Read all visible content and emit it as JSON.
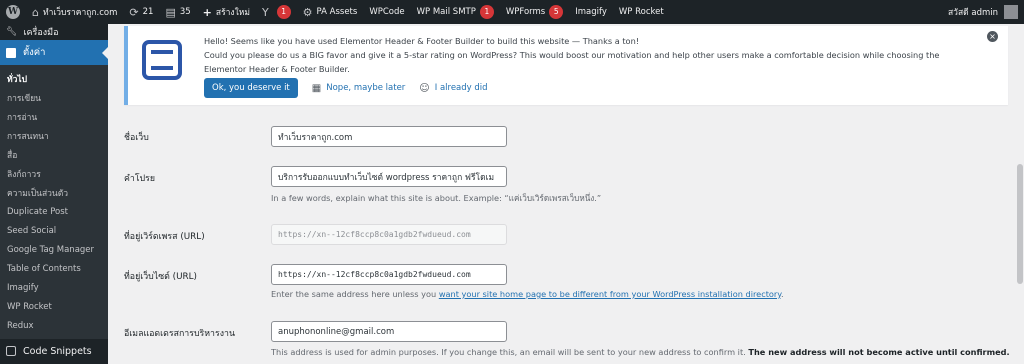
{
  "adminbar": {
    "site_name": "ทำเว็บราคาถูก.com",
    "updates_count": "21",
    "comments_count": "35",
    "new_label": "สร้างใหม่",
    "yoast_badge": "1",
    "pa_assets": "PA Assets",
    "wpcode": "WPCode",
    "wp_mail_smtp": "WP Mail SMTP",
    "wp_mail_smtp_badge": "1",
    "wpforms": "WPForms",
    "wpforms_badge": "5",
    "imagify": "Imagify",
    "wp_rocket": "WP Rocket",
    "greeting": "สวัสดี admin"
  },
  "sidebar": {
    "tools": "เครื่องมือ",
    "settings": "ตั้งค่า",
    "items": [
      "ทั่วไป",
      "การเขียน",
      "การอ่าน",
      "การสนทนา",
      "สื่อ",
      "ลิงก์ถาวร",
      "ความเป็นส่วนตัว",
      "Duplicate Post",
      "Seed Social",
      "Google Tag Manager",
      "Table of Contents",
      "Imagify",
      "WP Rocket",
      "Redux"
    ],
    "code_snippets": "Code Snippets"
  },
  "notice": {
    "line1": "Hello! Seems like you have used Elementor Header & Footer Builder to build this website — Thanks a ton!",
    "line2": "Could you please do us a BIG favor and give it a 5-star rating on WordPress? This would boost our motivation and help other users make a comfortable decision while choosing the Elementor Header & Footer Builder.",
    "btn_ok": "Ok, you deserve it",
    "btn_later": "Nope, maybe later",
    "btn_did": "I already did"
  },
  "form": {
    "site_title_label": "ชื่อเว็บ",
    "site_title_value": "ทำเว็บราคาถูก.com",
    "tagline_label": "คำโปรย",
    "tagline_value": "บริการรับออกแบบทำเว็บไซต์ wordpress ราคาถูก ฟรีโดเม",
    "tagline_desc": "In a few words, explain what this site is about. Example: “แค่เว็บเวิร์ดเพรสเว็บหนึ่ง.”",
    "wp_address_label": "ที่อยู่เวิร์ดเพรส (URL)",
    "wp_address_value": "https://xn--12cf8ccp8c0a1gdb2fwdueud.com",
    "site_address_label": "ที่อยู่เว็บไซต์ (URL)",
    "site_address_value": "https://xn--12cf8ccp8c0a1gdb2fwdueud.com",
    "site_address_desc": "Enter the same address here unless you ",
    "site_address_link": "want your site home page to be different from your WordPress installation directory",
    "site_address_desc_end": ".",
    "email_label": "อีเมลแอดเดรสการบริหารงาน",
    "email_value": "anuphononline@gmail.com",
    "email_desc": "This address is used for admin purposes. If you change this, an email will be sent to your new address to confirm it. ",
    "email_desc_bold": "The new address will not become active until confirmed."
  }
}
